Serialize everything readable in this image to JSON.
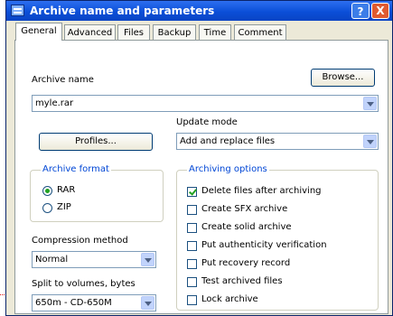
{
  "window": {
    "title": "Archive name and parameters",
    "help_label": "?",
    "close_label": "X"
  },
  "tabs": [
    "General",
    "Advanced",
    "Files",
    "Backup",
    "Time",
    "Comment"
  ],
  "general": {
    "archive_name_label": "Archive name",
    "archive_name_value": "myle.rar",
    "browse_label": "Browse...",
    "update_mode_label": "Update mode",
    "update_mode_value": "Add and replace files",
    "profiles_label": "Profiles...",
    "archive_format": {
      "title": "Archive format",
      "options": [
        {
          "label": "RAR",
          "selected": true
        },
        {
          "label": "ZIP",
          "selected": false
        }
      ]
    },
    "compression_method_label": "Compression method",
    "compression_method_value": "Normal",
    "split_label": "Split to volumes, bytes",
    "split_value": "650m - CD-650M",
    "archiving_options": {
      "title": "Archiving options",
      "items": [
        {
          "label": "Delete files after archiving",
          "checked": true
        },
        {
          "label": "Create SFX archive",
          "checked": false
        },
        {
          "label": "Create solid archive",
          "checked": false
        },
        {
          "label": "Put authenticity verification",
          "checked": false
        },
        {
          "label": "Put recovery record",
          "checked": false
        },
        {
          "label": "Test archived files",
          "checked": false
        },
        {
          "label": "Lock archive",
          "checked": false
        }
      ]
    }
  },
  "colors": {
    "titlebar": "#0b4fd8",
    "group_title": "#0046d5",
    "check_mark": "#21a121",
    "annotation": "#d11111"
  }
}
